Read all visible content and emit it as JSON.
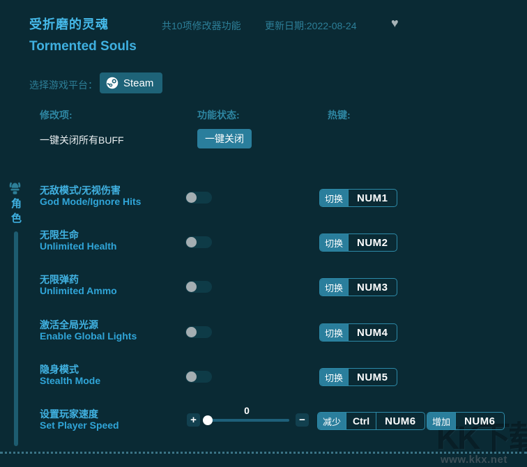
{
  "header": {
    "title_cn": "受折磨的灵魂",
    "title_en": "Tormented Souls",
    "feature_count": "共10项修改器功能",
    "update_date": "更新日期:2022-08-24",
    "favorite_glyph": "♥"
  },
  "platform": {
    "label": "选择游戏平台：",
    "selected": "Steam"
  },
  "table_headers": {
    "item": "修改项:",
    "status": "功能状态:",
    "hotkey": "热键:"
  },
  "master": {
    "label": "一键关闭所有BUFF",
    "button_label": "一键关闭"
  },
  "sidebar": {
    "category": "角色",
    "icon": "helmet-icon"
  },
  "features": [
    {
      "cn": "无敌模式/无视伤害",
      "en": "God Mode/Ignore Hits",
      "enabled": false,
      "hotkey": {
        "action": "切换",
        "key": "NUM1"
      }
    },
    {
      "cn": "无限生命",
      "en": "Unlimited Health",
      "enabled": false,
      "hotkey": {
        "action": "切换",
        "key": "NUM2"
      }
    },
    {
      "cn": "无限弹药",
      "en": "Unlimited Ammo",
      "enabled": false,
      "hotkey": {
        "action": "切换",
        "key": "NUM3"
      }
    },
    {
      "cn": "激活全局光源",
      "en": "Enable Global Lights",
      "enabled": false,
      "hotkey": {
        "action": "切换",
        "key": "NUM4"
      }
    },
    {
      "cn": "隐身模式",
      "en": "Stealth Mode",
      "enabled": false,
      "hotkey": {
        "action": "切换",
        "key": "NUM5"
      }
    }
  ],
  "speed_row": {
    "cn": "设置玩家速度",
    "en": "Set Player Speed",
    "value": "0",
    "plus_glyph": "+",
    "minus_glyph": "−",
    "decrease": {
      "action": "减少",
      "mod": "Ctrl",
      "key": "NUM6"
    },
    "increase": {
      "action": "增加",
      "key": "NUM6"
    }
  },
  "watermark": {
    "logo": "KK下载",
    "url": "www.kkx.net"
  },
  "colors": {
    "background": "#0a2a34",
    "accent_cyan": "#3fb0e0",
    "muted_teal": "#2d7f98",
    "button_teal": "#2a7e9c",
    "steam_button": "#1e6378",
    "hotkey_border": "#2d8aa8",
    "toggle_track": "#0e3b47",
    "toggle_knob": "#a4aeb2"
  }
}
